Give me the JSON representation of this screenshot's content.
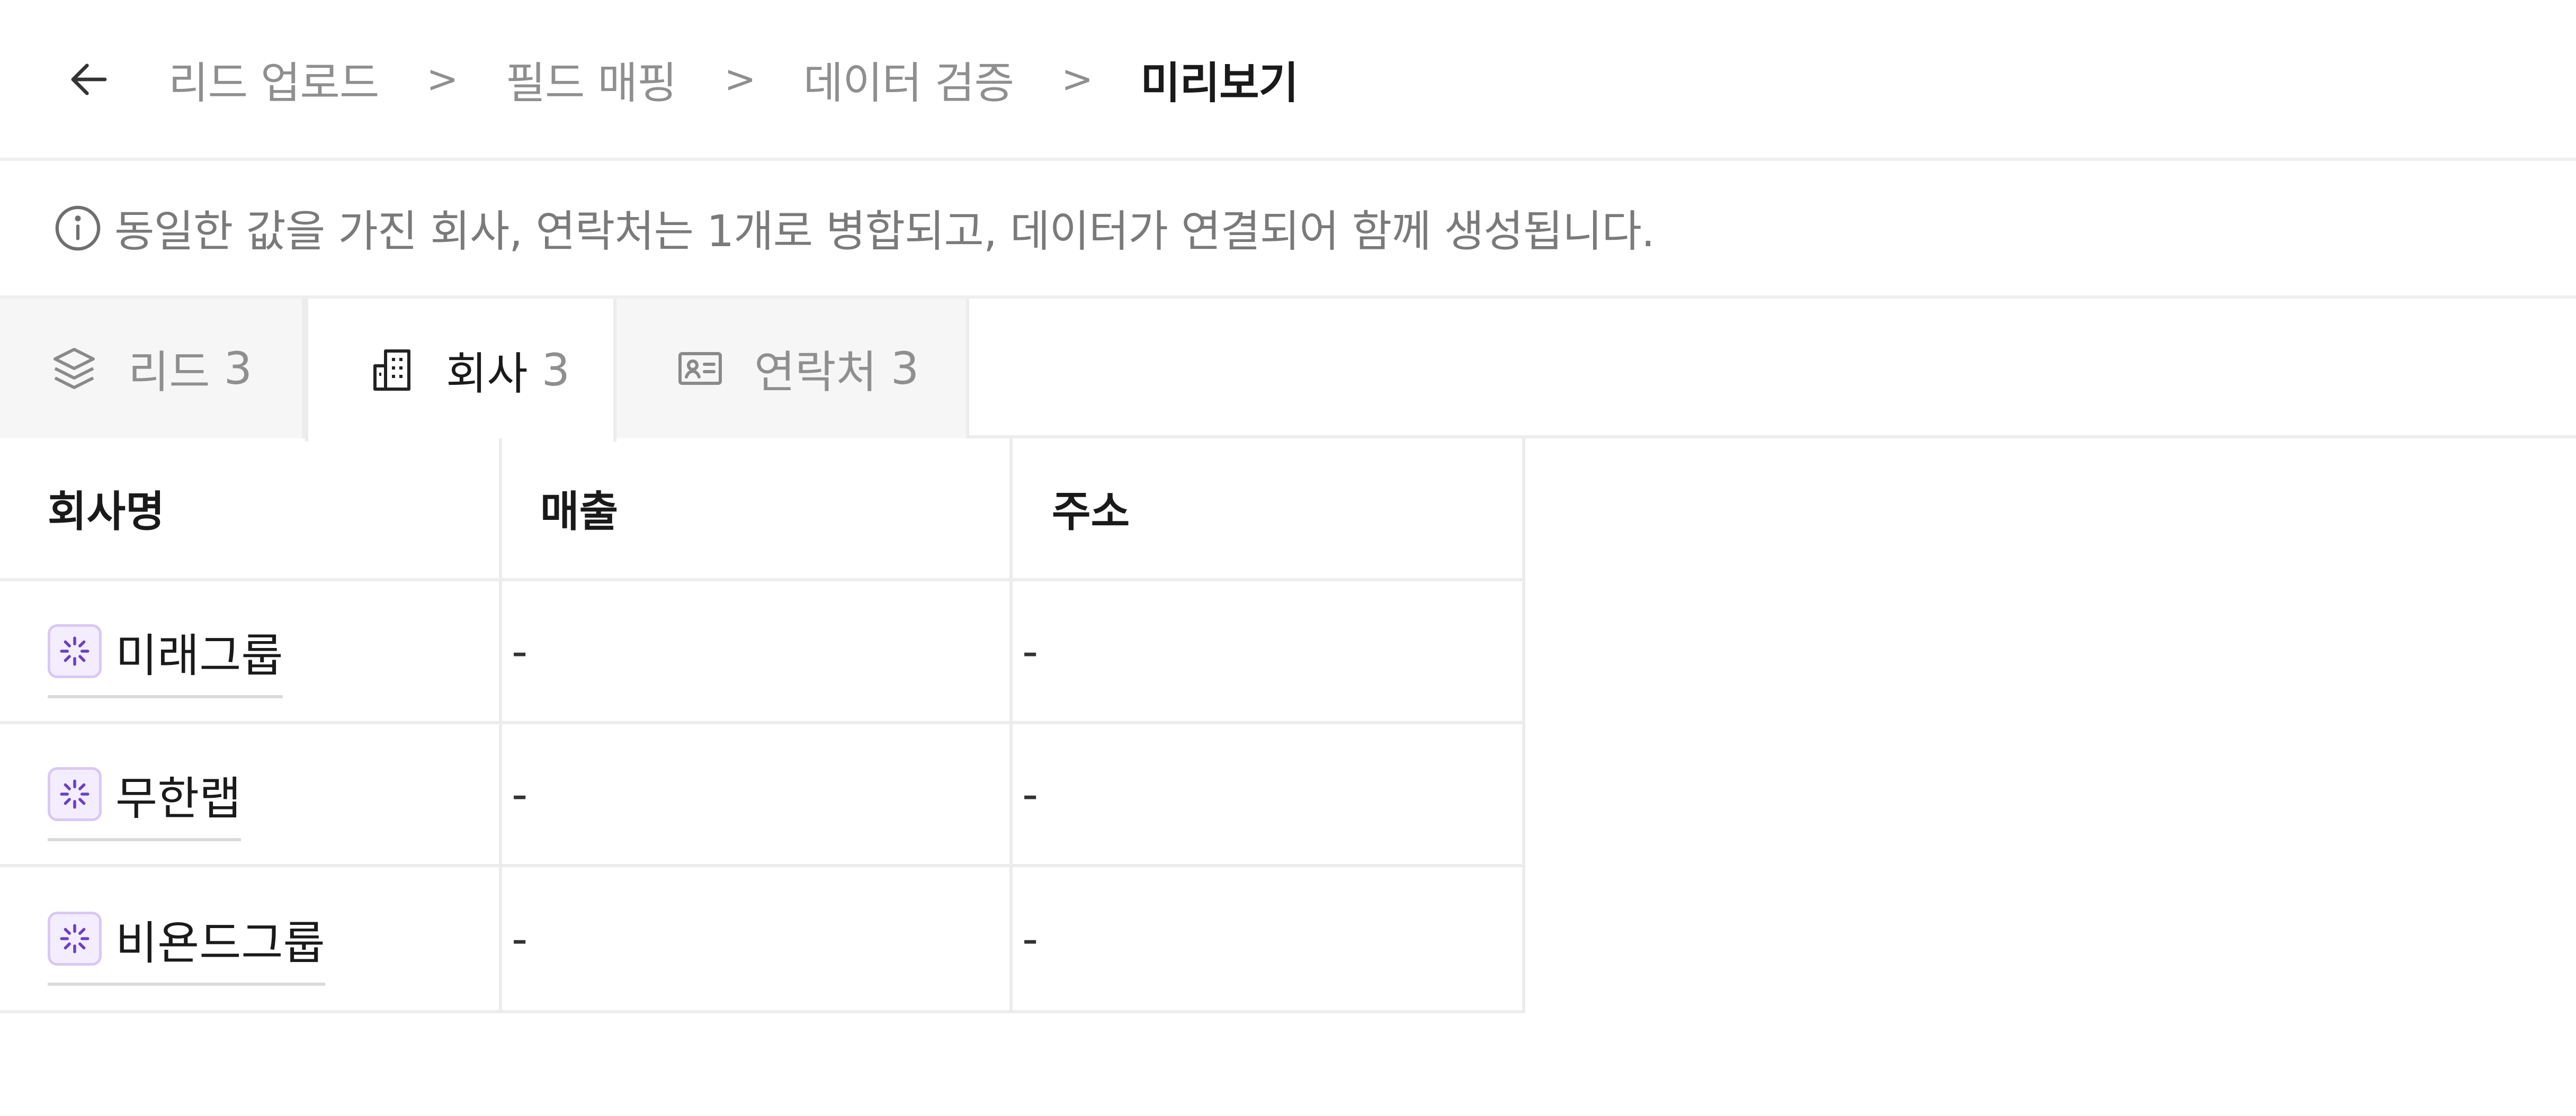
{
  "header": {
    "back_icon": "arrow-left-icon",
    "breadcrumb": [
      "리드 업로드",
      "필드 매핑",
      "데이터 검증",
      "미리보기"
    ],
    "separator": ">"
  },
  "info": {
    "icon": "info-circle-icon",
    "text": "동일한 값을 가진 회사, 연락처는 1개로 병합되고, 데이터가 연결되어 함께 생성됩니다."
  },
  "tabs": [
    {
      "label": "리드",
      "count": "3",
      "icon": "layers-icon",
      "active": false
    },
    {
      "label": "회사",
      "count": "3",
      "icon": "building-icon",
      "active": true
    },
    {
      "label": "연락처",
      "count": "3",
      "icon": "contact-card-icon",
      "active": false
    }
  ],
  "table": {
    "columns": [
      "회사명",
      "매출",
      "주소"
    ],
    "rows": [
      {
        "name": "미래그룹",
        "revenue": "-",
        "address": "-"
      },
      {
        "name": "무한랩",
        "revenue": "-",
        "address": "-"
      },
      {
        "name": "비욘드그룹",
        "revenue": "-",
        "address": "-"
      }
    ],
    "row_icon": "loading-sparkle-icon"
  },
  "colors": {
    "accent_purple": "#7b4fd6",
    "badge_bg": "#f3edff",
    "muted_text": "#8f8f8f",
    "border": "#ececec"
  }
}
